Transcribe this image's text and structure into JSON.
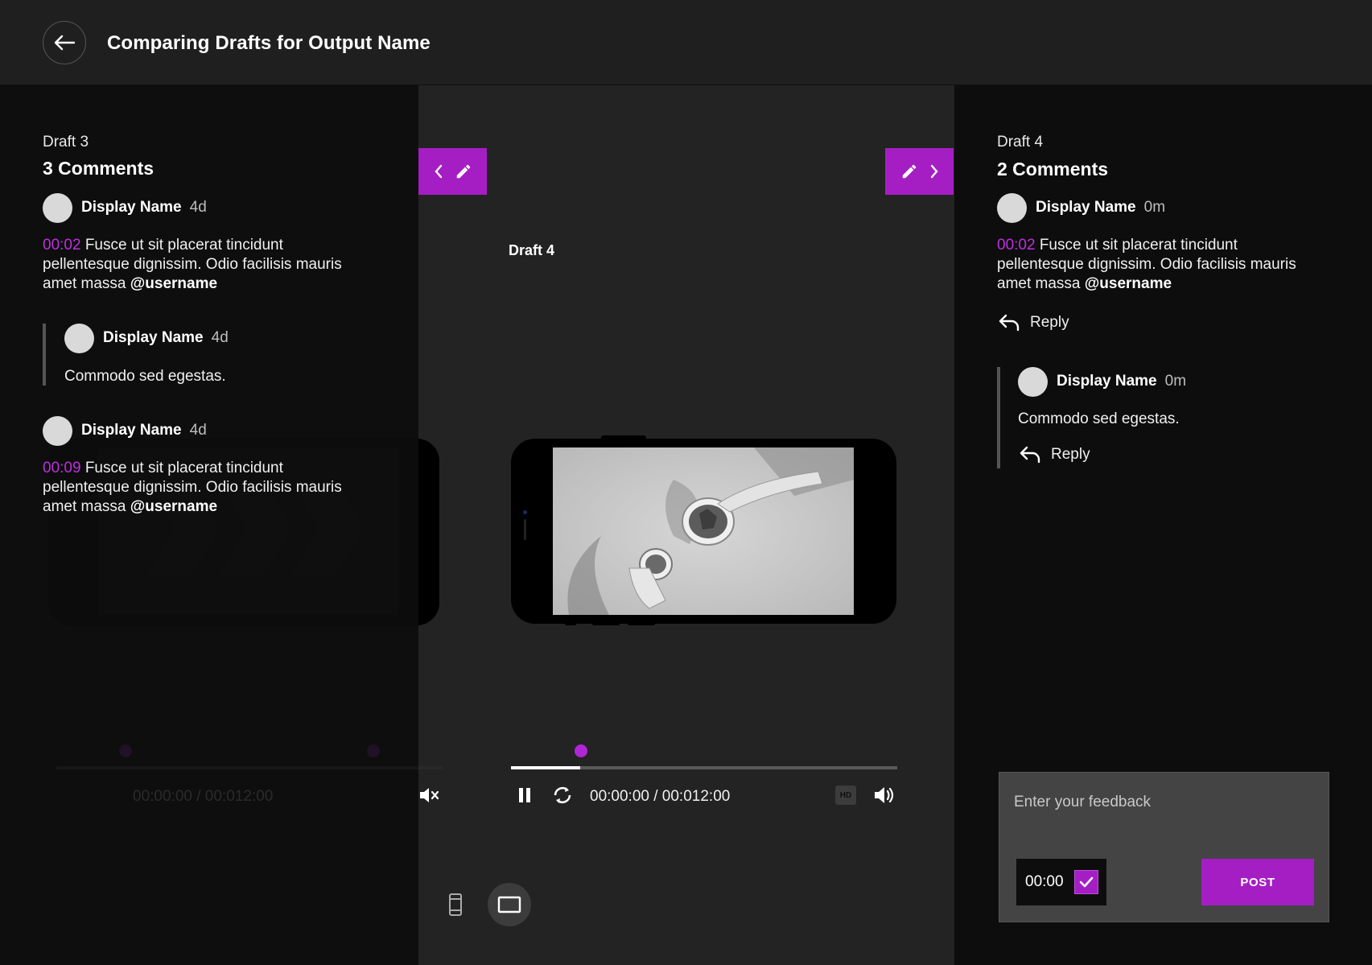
{
  "header": {
    "title": "Comparing Drafts for Output Name"
  },
  "left": {
    "draft": "Draft 3",
    "count": "3 Comments",
    "comments": [
      {
        "name": "Display Name",
        "time": "4d",
        "ts": "00:02",
        "text": "Fusce ut sit placerat tincidunt pellentesque dignissim. Odio facilisis mauris amet massa",
        "mention": "@username"
      },
      {
        "name": "Display Name",
        "time": "4d",
        "text": "Commodo sed egestas."
      },
      {
        "name": "Display Name",
        "time": "4d",
        "ts": "00:09",
        "text": "Fusce ut sit placerat tincidunt pellentesque dignissim. Odio facilisis mauris amet massa",
        "mention": "@username"
      }
    ],
    "player": {
      "time": "00:00:00 / 00:012:00"
    }
  },
  "center": {
    "draft": "Draft 4",
    "player": {
      "time": "00:00:00 / 00:012:00",
      "progress": 0.18,
      "hd": "HD"
    }
  },
  "right": {
    "draft": "Draft 4",
    "count": "2 Comments",
    "comments": [
      {
        "name": "Display Name",
        "time": "0m",
        "ts": "00:02",
        "text": "Fusce ut sit placerat tincidunt pellentesque dignissim. Odio facilisis mauris amet massa",
        "mention": "@username",
        "reply": "Reply"
      },
      {
        "name": "Display Name",
        "time": "0m",
        "text": "Commodo sed egestas.",
        "reply": "Reply"
      }
    ]
  },
  "feedback": {
    "placeholder": "Enter your feedback",
    "timestamp": "00:00",
    "post": "POST"
  },
  "colors": {
    "accent": "#a51ec4",
    "timestamp": "#c02ee0"
  }
}
